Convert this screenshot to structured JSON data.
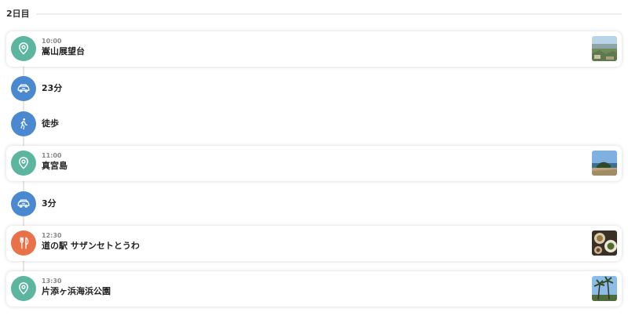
{
  "day": {
    "label": "2日目"
  },
  "colors": {
    "spot": "#5bb59f",
    "transport": "#4a89d0",
    "food": "#e8714a"
  },
  "timeline": [
    {
      "kind": "spot",
      "time": "10:00",
      "title": "嵩山展望台",
      "icon": "map-pin-icon",
      "thumbnail": "mountain-view-photo"
    },
    {
      "kind": "transport",
      "title": "23分",
      "icon": "car-icon"
    },
    {
      "kind": "transport",
      "title": "徒歩",
      "icon": "walking-icon"
    },
    {
      "kind": "spot",
      "time": "11:00",
      "title": "真宮島",
      "icon": "map-pin-icon",
      "thumbnail": "island-photo"
    },
    {
      "kind": "transport",
      "title": "3分",
      "icon": "car-icon"
    },
    {
      "kind": "food",
      "time": "12:30",
      "title": "道の駅 サザンセトとうわ",
      "icon": "fork-knife-icon",
      "thumbnail": "food-photo"
    },
    {
      "kind": "spot",
      "time": "13:30",
      "title": "片添ヶ浜海浜公園",
      "icon": "map-pin-icon",
      "thumbnail": "palm-beach-photo"
    }
  ]
}
